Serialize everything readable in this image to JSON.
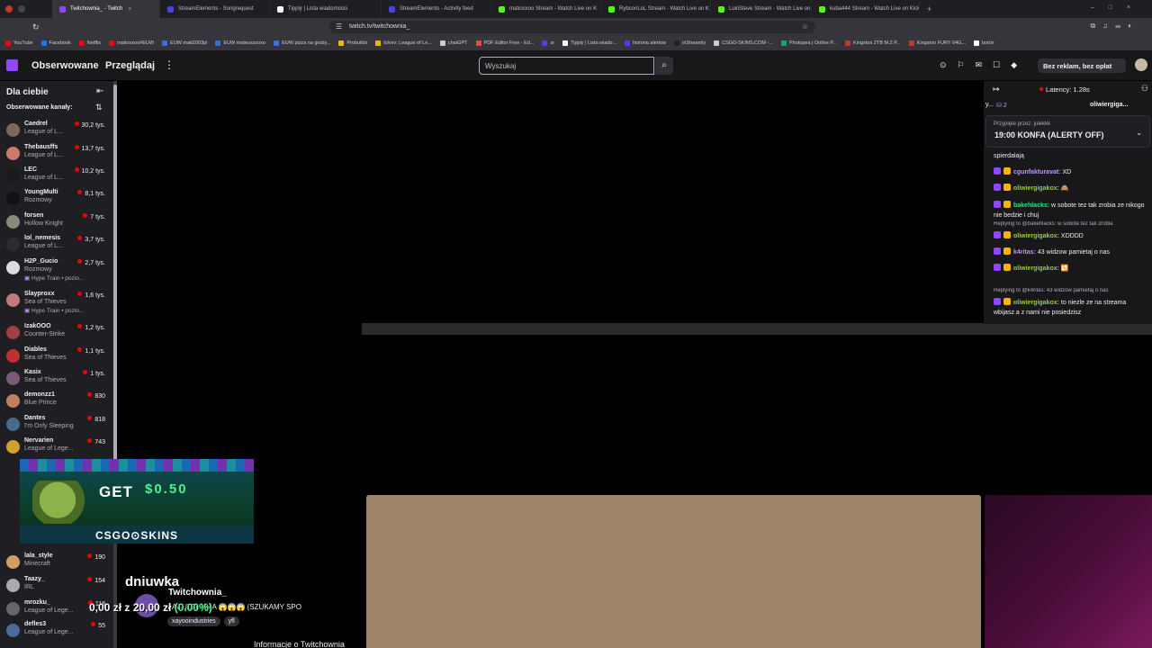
{
  "browser": {
    "tabs": [
      {
        "label": "Twitchownia_ - Twitch",
        "color": "#9147ff",
        "active": true
      },
      {
        "label": "StreamElements - Songrequest",
        "color": "#4b3ff0",
        "active": false
      },
      {
        "label": "Tipply | Lista wiadomości",
        "color": "#ffffff",
        "active": false
      },
      {
        "label": "StreamElements - Activity feed",
        "color": "#4b3ff0",
        "active": false
      },
      {
        "label": "matiosxoo Stream - Watch Live on K",
        "color": "#53fc18",
        "active": false
      },
      {
        "label": "RybsonLoL Stream - Watch Live on K",
        "color": "#53fc18",
        "active": false
      },
      {
        "label": "LukiSteve Stream - Watch Live on Kic",
        "color": "#53fc18",
        "active": false
      },
      {
        "label": "kuba444 Stream - Watch Live on Kick",
        "color": "#53fc18",
        "active": false
      }
    ],
    "url": "twitch.tv/twitchownia_",
    "bookmarks": [
      {
        "label": "YouTube",
        "color": "#ff0000"
      },
      {
        "label": "Facebook",
        "color": "#1877f2"
      },
      {
        "label": "Netflix",
        "color": "#e50914"
      },
      {
        "label": "matiosxoo#EUW",
        "color": "#e50914"
      },
      {
        "label": "EUW mati2003pl",
        "color": "#3a6fd8"
      },
      {
        "label": "EUW mateuszxoxo",
        "color": "#3a6fd8"
      },
      {
        "label": "EUW pizza na gruby...",
        "color": "#3a6fd8"
      },
      {
        "label": "Probuilds",
        "color": "#f5b400"
      },
      {
        "label": "lolvvv: League of Le...",
        "color": "#f5b400"
      },
      {
        "label": "chatGPT",
        "color": "#cccccc"
      },
      {
        "label": "PDF Editor Free - Ed...",
        "color": "#e74c3c"
      },
      {
        "label": "sr",
        "color": "#4b3ff0"
      },
      {
        "label": "Tipply | Lista wiado...",
        "color": "#ffffff"
      },
      {
        "label": "historia alertow",
        "color": "#4b3ff0"
      },
      {
        "label": "inStreamly",
        "color": "#222222"
      },
      {
        "label": "CSGO-SKINS.COM -...",
        "color": "#cccccc"
      },
      {
        "label": "Photopea | Online P...",
        "color": "#1aa07a"
      },
      {
        "label": "Kingston 2TB M.2 P...",
        "color": "#c0392b"
      },
      {
        "label": "Kingston FURY 64G...",
        "color": "#c0392b"
      },
      {
        "label": "botrix",
        "color": "#ffffff"
      }
    ]
  },
  "nav": {
    "following": "Obserwowane",
    "browse": "Przeglądaj",
    "more": "⋮",
    "search_placeholder": "Wyszukaj",
    "no_ads": "Bez reklam, bez opłat"
  },
  "sidebar": {
    "title": "Dla ciebie",
    "subtitle": "Obserwowane kanały:",
    "channels": [
      {
        "name": "Caedrel",
        "game": "League of L...",
        "viewers": "30,2 tys.",
        "color": "#7a6a5a"
      },
      {
        "name": "Thebausffs",
        "game": "League of L...",
        "viewers": "13,7 tys.",
        "color": "#c97a6a"
      },
      {
        "name": "LEC",
        "game": "League of L...",
        "viewers": "10,2 tys.",
        "color": "#1a1a1a"
      },
      {
        "name": "YoungMulti",
        "game": "Rozmowy",
        "viewers": "8,1 tys.",
        "color": "#111111"
      },
      {
        "name": "forsen",
        "game": "Hollow Knight",
        "viewers": "7 tys.",
        "color": "#8a8a7a"
      },
      {
        "name": "lol_nemesis",
        "game": "League of L...",
        "viewers": "3,7 tys.",
        "color": "#2a2a3a"
      },
      {
        "name": "H2P_Gucio",
        "game": "Rozmowy",
        "extra": "Hype Train • pozio...",
        "viewers": "2,7 tys.",
        "color": "#dcdcdc"
      },
      {
        "name": "Slayproxx",
        "game": "Sea of Thieves",
        "extra": "Hype Train • pozio...",
        "viewers": "1,6 tys.",
        "color": "#c07a7a"
      },
      {
        "name": "IzakOOO",
        "game": "Counter-Strike",
        "viewers": "1,2 tys.",
        "color": "#a04040"
      },
      {
        "name": "Diables",
        "game": "Sea of Thieves",
        "viewers": "1,1 tys.",
        "color": "#c03030"
      },
      {
        "name": "Kasix",
        "game": "Sea of Thieves",
        "viewers": "1 tys.",
        "color": "#7a5a7a"
      },
      {
        "name": "demonzz1",
        "game": "Blue Prince",
        "viewers": "830",
        "color": "#c08060"
      },
      {
        "name": "Dantes",
        "game": "I'm Only Sleeping",
        "viewers": "818",
        "color": "#4a6a8a"
      },
      {
        "name": "Nervarien",
        "game": "League of Lege...",
        "viewers": "743",
        "color": "#d0a030"
      },
      {
        "name": "lala_style",
        "game": "Minecraft",
        "viewers": "190",
        "color": "#d0a060"
      },
      {
        "name": "Taazy_",
        "game": "IRL",
        "viewers": "154",
        "color": "#aaaaaa"
      },
      {
        "name": "mrozku_",
        "game": "League of Lege...",
        "viewers": "118",
        "color": "#666666"
      },
      {
        "name": "defles3",
        "game": "League of Lege...",
        "viewers": "55",
        "color": "#4a6a9a"
      }
    ]
  },
  "ad": {
    "get": "GET",
    "amount": "$0.50",
    "brand": "CSGO⊙SKINS"
  },
  "stream": {
    "title_text": "dniuwka",
    "channel": "Twitchownia_",
    "subtitle": "JACUZZI MMA 😱😱😱 (SZUKAMY SPO",
    "tags": [
      "xayooindustries",
      "yfl"
    ],
    "goal_amount": "0,00 zł z 20,00 zł",
    "goal_percent": "(0.00%)",
    "info_link": "Informacje o Twitchownia_"
  },
  "chat": {
    "latency": "Latency: 1.28s",
    "gift_count": "2",
    "strip_user": "oliwiergiga...",
    "pinned_by": "Przypięte przez: julekkk",
    "pinned_message": "19:00 KONFA (ALERTY OFF)",
    "messages": [
      {
        "user": "",
        "text": "spierdalają",
        "color": "#efeff1"
      },
      {
        "user": "cgunfakturavat:",
        "text": "XD",
        "color": "#bf94ff"
      },
      {
        "user": "oliwiergigakox:",
        "text": "🙈",
        "color": "#9acd32"
      },
      {
        "user": "bakehlacks:",
        "text": "w sobote tez tak zrobia ze nikogo nie bedzie i chuj",
        "color": "#00ff7f"
      },
      {
        "user": "oliwiergigakox:",
        "text": "XDDDD",
        "color": "#9acd32",
        "reply": "Replying to @bakehlacks: w sobote tez tak zrobia"
      },
      {
        "user": "k4ritas:",
        "text": "43 widzow pamietaj o nas",
        "color": "#bf94ff"
      },
      {
        "user": "oliwiergigakox:",
        "text": "🔁",
        "color": "#9acd32"
      },
      {
        "user": "oliwiergigakox:",
        "text": "to niezle ze na streama wbijasz a z nami nie posiedzisz",
        "color": "#9acd32",
        "reply": "Replying to @k4ritas: 43 widzow pamietaj o nas"
      }
    ]
  }
}
